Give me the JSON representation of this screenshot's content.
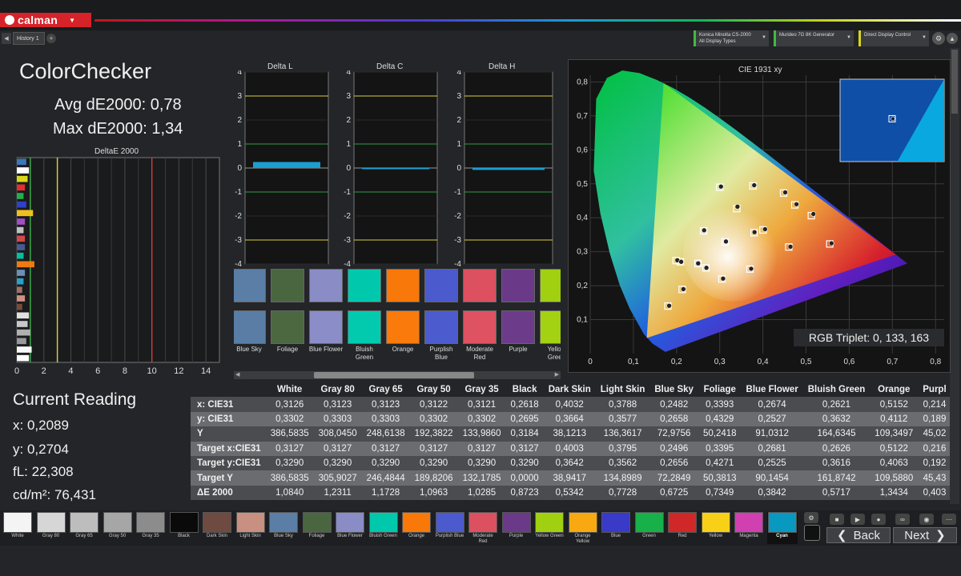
{
  "app": {
    "name": "calman",
    "history_tab": "History 1"
  },
  "devices": [
    {
      "line1": "Konica Minolta CS-2000",
      "line2": "All Display Types",
      "accent": "#3dbd3d"
    },
    {
      "line1": "Murideo 7G 8K Generator",
      "line2": "",
      "accent": "#3dbd3d"
    },
    {
      "line1": "Direct Display Control",
      "line2": "",
      "accent": "#d8d81a"
    }
  ],
  "summary": {
    "title": "ColorChecker",
    "avg": "Avg dE2000: 0,78",
    "max": "Max dE2000: 1,34"
  },
  "deltae_chart": {
    "title": "DeltaE 2000",
    "xticks": [
      "0",
      "2",
      "4",
      "6",
      "8",
      "10",
      "12",
      "14"
    ],
    "bars": [
      {
        "value": 0.7,
        "color": "#3b78b8"
      },
      {
        "value": 0.9,
        "color": "#ffffff"
      },
      {
        "value": 0.8,
        "color": "#d8d81a"
      },
      {
        "value": 0.6,
        "color": "#e03030"
      },
      {
        "value": 0.5,
        "color": "#22b04a"
      },
      {
        "value": 0.7,
        "color": "#3040c8"
      },
      {
        "value": 1.2,
        "color": "#f0c020"
      },
      {
        "value": 0.6,
        "color": "#a050c0"
      },
      {
        "value": 0.5,
        "color": "#c0c0c0"
      },
      {
        "value": 0.6,
        "color": "#d04848"
      },
      {
        "value": 0.6,
        "color": "#4a5a90"
      },
      {
        "value": 0.5,
        "color": "#00c0a0"
      },
      {
        "value": 1.3,
        "color": "#f07a10"
      },
      {
        "value": 0.6,
        "color": "#6d8fb5"
      },
      {
        "value": 0.5,
        "color": "#2aa0c8"
      },
      {
        "value": 0.4,
        "color": "#a07060"
      },
      {
        "value": 0.6,
        "color": "#d09080"
      },
      {
        "value": 0.4,
        "color": "#7a4a3a"
      },
      {
        "value": 0.9,
        "color": "#e0e0e0"
      },
      {
        "value": 0.8,
        "color": "#c8c8c8"
      },
      {
        "value": 1.0,
        "color": "#b0b0b0"
      },
      {
        "value": 0.7,
        "color": "#999999"
      },
      {
        "value": 1.1,
        "color": "#f8f8f8"
      },
      {
        "value": 0.9,
        "color": "#ffffff"
      }
    ],
    "lines": [
      {
        "value": 1,
        "color": "#3cb44b"
      },
      {
        "value": 3,
        "color": "#e2d23a"
      },
      {
        "value": 10,
        "color": "#d23c3c"
      }
    ]
  },
  "current": {
    "title": "Current Reading",
    "x": "x: 0,2089",
    "y": "y: 0,2704",
    "fl": "fL: 22,308",
    "cdm2": "cd/m²: 76,431"
  },
  "delta_charts": [
    {
      "title": "Delta L",
      "yticks": [
        "4",
        "3",
        "2",
        "1",
        "0",
        "-1",
        "-2",
        "-3",
        "-4"
      ],
      "value": 0.25
    },
    {
      "title": "Delta C",
      "yticks": [
        "4",
        "3",
        "2",
        "1",
        "0",
        "-1",
        "-2",
        "-3",
        "-4"
      ],
      "value": 0.0
    },
    {
      "title": "Delta H",
      "yticks": [
        "4",
        "3",
        "2",
        "1",
        "0",
        "-1",
        "-2",
        "-3",
        "-4"
      ],
      "value": -0.08
    }
  ],
  "swatches": [
    {
      "label": "Blue Sky",
      "top": "#5b7ea6",
      "bottom": "#5a7da5"
    },
    {
      "label": "Foliage",
      "top": "#4a6640",
      "bottom": "#4b6841"
    },
    {
      "label": "Blue Flower",
      "top": "#8a8cc6",
      "bottom": "#8b8dc8"
    },
    {
      "label": "Bluish Green",
      "top": "#00c8ad",
      "bottom": "#02caaf"
    },
    {
      "label": "Orange",
      "top": "#f8780a",
      "bottom": "#fa7a0c"
    },
    {
      "label": "Purplish Blue",
      "top": "#4b5acc",
      "bottom": "#4c5bce"
    },
    {
      "label": "Moderate Red",
      "top": "#dc5060",
      "bottom": "#de5262"
    },
    {
      "label": "Purple",
      "top": "#6a3a88",
      "bottom": "#6c3c8a"
    },
    {
      "label": "Yellow Green",
      "top": "#a0d010",
      "bottom": "#a2d212"
    }
  ],
  "cie": {
    "title": "CIE 1931 xy",
    "xticks": [
      "0",
      "0,1",
      "0,2",
      "0,3",
      "0,4",
      "0,5",
      "0,6",
      "0,7",
      "0,8"
    ],
    "yticks": [
      "0,1",
      "0,2",
      "0,3",
      "0,4",
      "0,5",
      "0,6",
      "0,7",
      "0,8"
    ],
    "gamut": [
      [
        0.708,
        0.292
      ],
      [
        0.17,
        0.797
      ],
      [
        0.131,
        0.046
      ]
    ],
    "targets": [
      [
        0.3127,
        0.329
      ],
      [
        0.4003,
        0.3642
      ],
      [
        0.3795,
        0.3562
      ],
      [
        0.2496,
        0.2656
      ],
      [
        0.3395,
        0.4271
      ],
      [
        0.2681,
        0.2525
      ],
      [
        0.2626,
        0.3616
      ],
      [
        0.5122,
        0.4063
      ],
      [
        0.213,
        0.189
      ],
      [
        0.46,
        0.314
      ],
      [
        0.305,
        0.22
      ],
      [
        0.377,
        0.494
      ],
      [
        0.474,
        0.438
      ],
      [
        0.199,
        0.274
      ],
      [
        0.3,
        0.49
      ],
      [
        0.555,
        0.323
      ],
      [
        0.448,
        0.473
      ],
      [
        0.37,
        0.249
      ],
      [
        0.18,
        0.14
      ],
      [
        0.209,
        0.2704
      ]
    ],
    "measured": [
      [
        0.3126,
        0.3302
      ],
      [
        0.4032,
        0.3664
      ],
      [
        0.3788,
        0.3577
      ],
      [
        0.2482,
        0.2658
      ],
      [
        0.3393,
        0.4329
      ],
      [
        0.2674,
        0.2527
      ],
      [
        0.2621,
        0.3632
      ],
      [
        0.5152,
        0.4112
      ],
      [
        0.214,
        0.19
      ],
      [
        0.462,
        0.315
      ],
      [
        0.306,
        0.221
      ],
      [
        0.378,
        0.496
      ],
      [
        0.476,
        0.44
      ],
      [
        0.2,
        0.275
      ],
      [
        0.301,
        0.492
      ],
      [
        0.557,
        0.325
      ],
      [
        0.45,
        0.475
      ],
      [
        0.371,
        0.25
      ],
      [
        0.181,
        0.141
      ],
      [
        0.2089,
        0.2704
      ]
    ],
    "inset_point": [
      0.2089,
      0.2704
    ],
    "rgb_triplet": "RGB Triplet: 0, 133, 163"
  },
  "table": {
    "columns": [
      "White",
      "Gray 80",
      "Gray 65",
      "Gray 50",
      "Gray 35",
      "Black",
      "Dark Skin",
      "Light Skin",
      "Blue Sky",
      "Foliage",
      "Blue Flower",
      "Bluish Green",
      "Orange",
      "Purpl"
    ],
    "rows": [
      {
        "label": "x: CIE31",
        "cells": [
          "0,3126",
          "0,3123",
          "0,3123",
          "0,3122",
          "0,3121",
          "0,2618",
          "0,4032",
          "0,3788",
          "0,2482",
          "0,3393",
          "0,2674",
          "0,2621",
          "0,5152",
          "0,214"
        ]
      },
      {
        "label": "y: CIE31",
        "cells": [
          "0,3302",
          "0,3303",
          "0,3303",
          "0,3302",
          "0,3302",
          "0,2695",
          "0,3664",
          "0,3577",
          "0,2658",
          "0,4329",
          "0,2527",
          "0,3632",
          "0,4112",
          "0,189"
        ]
      },
      {
        "label": "Y",
        "cells": [
          "386,5835",
          "308,0450",
          "248,6138",
          "192,3822",
          "133,9860",
          "0,3184",
          "38,1213",
          "136,3617",
          "72,9756",
          "50,2418",
          "91,0312",
          "164,6345",
          "109,3497",
          "45,02"
        ]
      },
      {
        "label": "Target x:CIE31",
        "cells": [
          "0,3127",
          "0,3127",
          "0,3127",
          "0,3127",
          "0,3127",
          "0,3127",
          "0,4003",
          "0,3795",
          "0,2496",
          "0,3395",
          "0,2681",
          "0,2626",
          "0,5122",
          "0,216"
        ]
      },
      {
        "label": "Target y:CIE31",
        "cells": [
          "0,3290",
          "0,3290",
          "0,3290",
          "0,3290",
          "0,3290",
          "0,3290",
          "0,3642",
          "0,3562",
          "0,2656",
          "0,4271",
          "0,2525",
          "0,3616",
          "0,4063",
          "0,192"
        ]
      },
      {
        "label": "Target Y",
        "cells": [
          "386,5835",
          "305,9027",
          "246,4844",
          "189,8206",
          "132,1785",
          "0,0000",
          "38,9417",
          "134,8989",
          "72,2849",
          "50,3813",
          "90,1454",
          "161,8742",
          "109,5880",
          "45,43"
        ]
      },
      {
        "label": "ΔE 2000",
        "cells": [
          "1,0840",
          "1,2311",
          "1,1728",
          "1,0963",
          "1,0285",
          "0,8723",
          "0,5342",
          "0,7728",
          "0,6725",
          "0,7349",
          "0,3842",
          "0,5717",
          "1,3434",
          "0,403"
        ]
      }
    ]
  },
  "patches": [
    {
      "label": "White",
      "color": "#f4f4f4"
    },
    {
      "label": "Gray 80",
      "color": "#d6d6d6"
    },
    {
      "label": "Gray 65",
      "color": "#bdbdbd"
    },
    {
      "label": "Gray 50",
      "color": "#a6a6a6"
    },
    {
      "label": "Gray 35",
      "color": "#8c8c8c"
    },
    {
      "label": "Black",
      "color": "#0a0a0a"
    },
    {
      "label": "Dark Skin",
      "color": "#6e4a40"
    },
    {
      "label": "Light Skin",
      "color": "#c89080"
    },
    {
      "label": "Blue Sky",
      "color": "#5b7ea6"
    },
    {
      "label": "Foliage",
      "color": "#4a6640"
    },
    {
      "label": "Blue Flower",
      "color": "#8a8cc6"
    },
    {
      "label": "Bluish Green",
      "color": "#00c8ad"
    },
    {
      "label": "Orange",
      "color": "#f8780a"
    },
    {
      "label": "Purplish Blue",
      "color": "#4b5acc"
    },
    {
      "label": "Moderate Red",
      "color": "#dc5060"
    },
    {
      "label": "Purple",
      "color": "#6a3a88"
    },
    {
      "label": "Yellow Green",
      "color": "#a0d010"
    },
    {
      "label": "Orange Yellow",
      "color": "#f8a810"
    },
    {
      "label": "Blue",
      "color": "#3a3ac8"
    },
    {
      "label": "Green",
      "color": "#18b048"
    },
    {
      "label": "Red",
      "color": "#d02828"
    },
    {
      "label": "Yellow",
      "color": "#f8d018"
    },
    {
      "label": "Magenta",
      "color": "#d040b0"
    },
    {
      "label": "Cyan",
      "color": "#0898c0",
      "selected": true
    }
  ],
  "nav": {
    "back": "Back",
    "next": "Next"
  }
}
